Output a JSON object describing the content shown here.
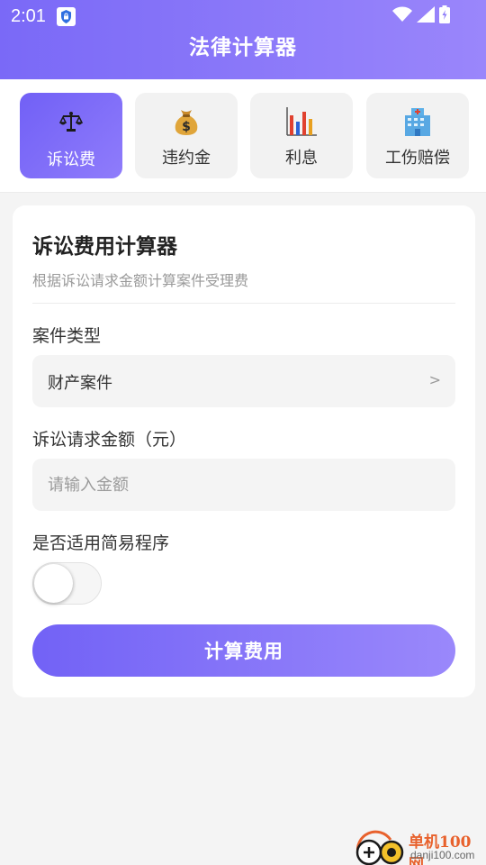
{
  "status_bar": {
    "time": "2:01",
    "icons": [
      "app-shield-icon",
      "wifi-icon",
      "signal-icon",
      "battery-icon"
    ]
  },
  "header": {
    "title": "法律计算器",
    "gradient": [
      "#7a69f7",
      "#9a86fb"
    ]
  },
  "tabs": [
    {
      "label": "诉讼费",
      "icon": "scales-icon",
      "active": true
    },
    {
      "label": "违约金",
      "icon": "money-bag-icon",
      "active": false
    },
    {
      "label": "利息",
      "icon": "bar-chart-icon",
      "active": false
    },
    {
      "label": "工伤赔偿",
      "icon": "hospital-icon",
      "active": false
    }
  ],
  "card": {
    "title": "诉讼费用计算器",
    "subtitle": "根据诉讼请求金额计算案件受理费"
  },
  "form": {
    "case_type_label": "案件类型",
    "case_type_value": "财产案件",
    "chevron": ">",
    "amount_label": "诉讼请求金额（元）",
    "amount_placeholder": "请输入金额",
    "amount_value": "",
    "simple_procedure_label": "是否适用简易程序",
    "simple_procedure_on": false,
    "calculate_label": "计算费用"
  },
  "watermark": {
    "name": "单机100网",
    "url": "danji100.com"
  },
  "colors": {
    "accent": "#7a69f7",
    "background": "#f4f4f4",
    "card": "#ffffff"
  }
}
